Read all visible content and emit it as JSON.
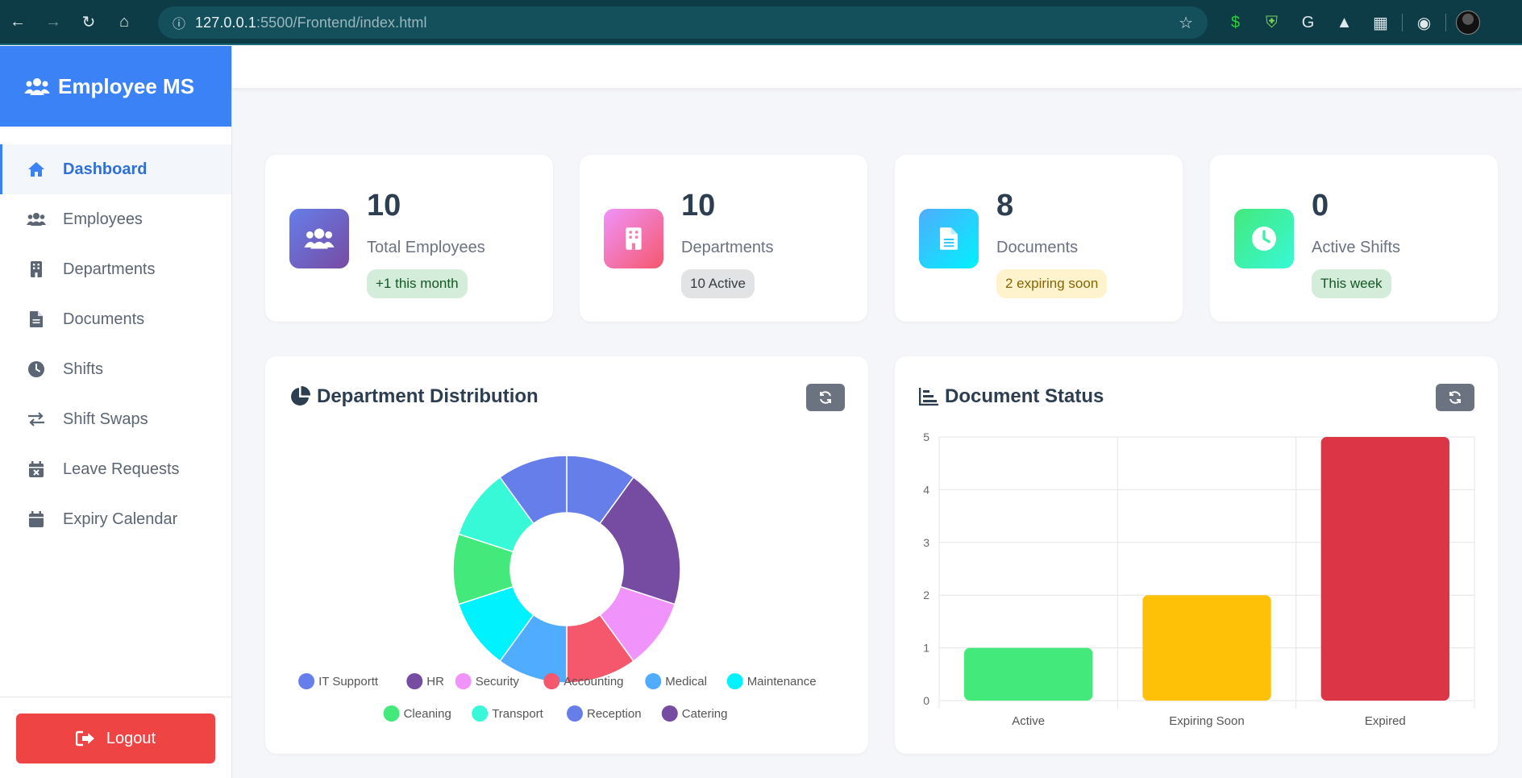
{
  "browser": {
    "url_host": "127.0.0.1",
    "url_rest": ":5500/Frontend/index.html"
  },
  "sidebar": {
    "brand": "Employee MS",
    "items": [
      {
        "label": "Dashboard",
        "icon": "home-icon",
        "active": true
      },
      {
        "label": "Employees",
        "icon": "users-icon"
      },
      {
        "label": "Departments",
        "icon": "building-icon"
      },
      {
        "label": "Documents",
        "icon": "file-icon"
      },
      {
        "label": "Shifts",
        "icon": "clock-icon"
      },
      {
        "label": "Shift Swaps",
        "icon": "exchange-icon"
      },
      {
        "label": "Leave Requests",
        "icon": "calendar-x-icon"
      },
      {
        "label": "Expiry Calendar",
        "icon": "calendar-icon"
      }
    ],
    "logout_label": "Logout"
  },
  "stats": [
    {
      "value": "10",
      "label": "Total Employees",
      "badge": "+1 this month",
      "icon": "users-icon",
      "gradient": [
        "#667eea",
        "#764ba2"
      ],
      "badge_bg": "#d4edda",
      "badge_fg": "#155724"
    },
    {
      "value": "10",
      "label": "Departments",
      "badge": "10 Active",
      "icon": "building-icon",
      "gradient": [
        "#f093fb",
        "#f5576c"
      ],
      "badge_bg": "#e2e3e5",
      "badge_fg": "#383d41"
    },
    {
      "value": "8",
      "label": "Documents",
      "badge": "2 expiring soon",
      "icon": "file-icon",
      "gradient": [
        "#4facfe",
        "#00f2fe"
      ],
      "badge_bg": "#fff3cd",
      "badge_fg": "#856404"
    },
    {
      "value": "0",
      "label": "Active Shifts",
      "badge": "This week",
      "icon": "clock-icon",
      "gradient": [
        "#43e97b",
        "#38f9d7"
      ],
      "badge_bg": "#d4edda",
      "badge_fg": "#155724"
    }
  ],
  "panels": {
    "dept_title": "Department Distribution",
    "doc_title": "Document Status"
  },
  "chart_data": [
    {
      "type": "pie",
      "title": "Department Distribution",
      "categories": [
        "IT Supportt",
        "HR",
        "Security",
        "Accounting",
        "Medical",
        "Maintenance",
        "Cleaning",
        "Transport",
        "Reception",
        "Catering"
      ],
      "values": [
        1,
        2,
        1,
        1,
        1,
        1,
        1,
        1,
        1,
        0
      ],
      "colors": [
        "#667eea",
        "#764ba2",
        "#f093fb",
        "#f5576c",
        "#4facfe",
        "#00f2fe",
        "#43e97b",
        "#38f9d7",
        "#667eea",
        "#764ba2"
      ],
      "legend": "bottom"
    },
    {
      "type": "bar",
      "title": "Document Status",
      "categories": [
        "Active",
        "Expiring Soon",
        "Expired"
      ],
      "values": [
        1,
        2,
        5
      ],
      "colors": [
        "#43e97b",
        "#ffc107",
        "#dc3545"
      ],
      "ylim": [
        0,
        5
      ],
      "yticks": [
        "0",
        "1",
        "2",
        "3",
        "4",
        "5"
      ],
      "grid": true
    }
  ]
}
